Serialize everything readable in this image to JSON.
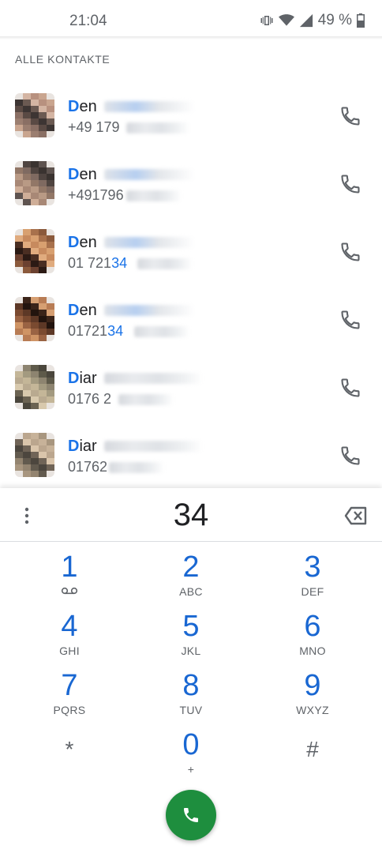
{
  "status_bar": {
    "time": "21:04",
    "battery": "49 %",
    "icons": [
      "vibrate-icon",
      "wifi-icon",
      "signal-icon",
      "battery-icon"
    ]
  },
  "contacts_header": "ALLE KONTAKTE",
  "contacts": [
    {
      "name_match": "D",
      "name_rest": "en",
      "number_pre": "+49 179",
      "number_match": "",
      "number_post": " "
    },
    {
      "name_match": "D",
      "name_rest": "en",
      "number_pre": "+491796",
      "number_match": "",
      "number_post": ""
    },
    {
      "name_match": "D",
      "name_rest": "en",
      "number_pre": "01 721",
      "number_match": "34",
      "number_post": ""
    },
    {
      "name_match": "D",
      "name_rest": "en",
      "number_pre": "01721",
      "number_match": "34",
      "number_post": ""
    },
    {
      "name_match": "D",
      "name_rest": "iar",
      "number_pre": "0176 2",
      "number_match": "",
      "number_post": ""
    },
    {
      "name_match": "D",
      "name_rest": "iar",
      "number_pre": "01762",
      "number_match": "",
      "number_post": ""
    }
  ],
  "dialpad": {
    "digits": "34",
    "keys": [
      {
        "num": "1",
        "sub": ""
      },
      {
        "num": "2",
        "sub": "ABC"
      },
      {
        "num": "3",
        "sub": "DEF"
      },
      {
        "num": "4",
        "sub": "GHI"
      },
      {
        "num": "5",
        "sub": "JKL"
      },
      {
        "num": "6",
        "sub": "MNO"
      },
      {
        "num": "7",
        "sub": "PQRS"
      },
      {
        "num": "8",
        "sub": "TUV"
      },
      {
        "num": "9",
        "sub": "WXYZ"
      },
      {
        "num": "*",
        "sub": ""
      },
      {
        "num": "0",
        "sub": "+"
      },
      {
        "num": "#",
        "sub": ""
      }
    ]
  },
  "colors": {
    "accent": "#1a73e8",
    "call_green": "#1e8e3e",
    "secondary_text": "#5f6368"
  }
}
